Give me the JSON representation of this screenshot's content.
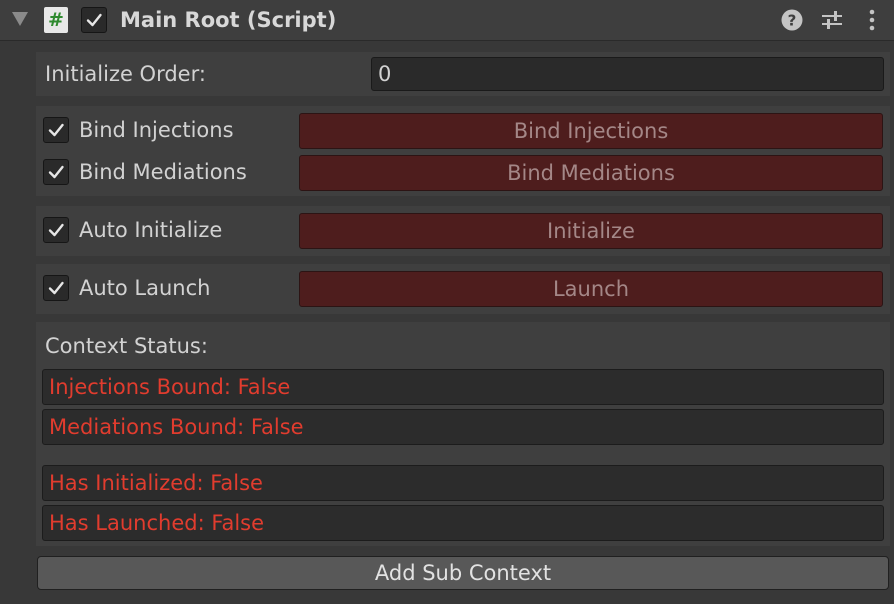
{
  "header": {
    "title": "Main Root (Script)",
    "script_icon": "#",
    "enabled": true,
    "icons": [
      "foldout-arrow-icon",
      "script-icon",
      "help-icon",
      "preset-sliders-icon",
      "kebab-menu-icon"
    ]
  },
  "initialize_order": {
    "label": "Initialize Order:",
    "value": "0"
  },
  "toggles": [
    {
      "label": "Bind Injections",
      "checked": true,
      "button": "Bind Injections"
    },
    {
      "label": "Bind Mediations",
      "checked": true,
      "button": "Bind Mediations"
    },
    {
      "label": "Auto Initialize",
      "checked": true,
      "button": "Initialize"
    },
    {
      "label": "Auto Launch",
      "checked": true,
      "button": "Launch"
    }
  ],
  "context_status": {
    "label": "Context Status:",
    "items": [
      "Injections Bound: False",
      "Mediations Bound: False",
      "Has Initialized: False",
      "Has Launched: False"
    ]
  },
  "add_sub_context": "Add Sub Context",
  "colors": {
    "action_button": "#4e1d1d",
    "status_text": "#e13c2e"
  }
}
